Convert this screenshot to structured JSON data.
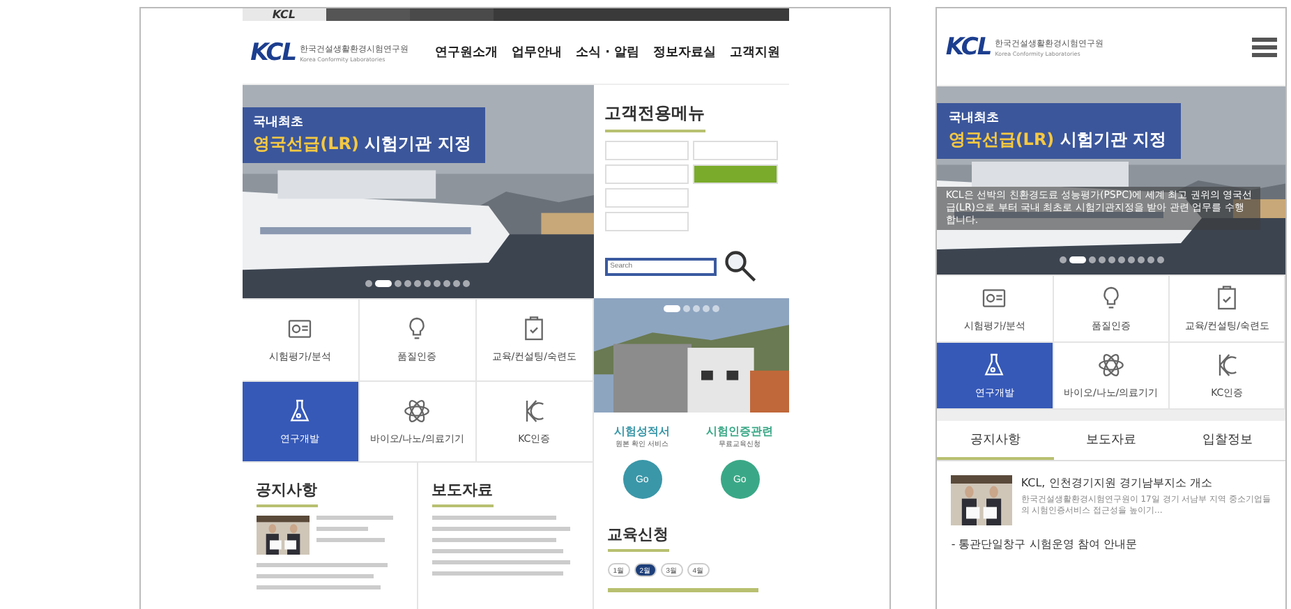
{
  "desktop": {
    "top_bar": {
      "logo": "KCL"
    },
    "header": {
      "logo": "KCL",
      "org_name": "한국건설생활환경시험연구원",
      "org_name_en": "Korea Conformity Laboratories",
      "nav": [
        "연구원소개",
        "업무안내",
        "소식 · 알림",
        "정보자료실",
        "고객지원"
      ]
    },
    "hero": {
      "kicker": "국내최초",
      "headline": "**영국선급(LR)** 시험기관 지정",
      "slides": [
        {
          "selected": false
        },
        {
          "selected": true
        },
        {
          "selected": false
        },
        {
          "selected": false
        },
        {
          "selected": false
        },
        {
          "selected": false
        },
        {
          "selected": false
        },
        {
          "selected": false
        },
        {
          "selected": false
        },
        {
          "selected": false
        }
      ]
    },
    "customer_menu": {
      "title": "고객전용메뉴",
      "search": {
        "placeholder": "Search"
      }
    },
    "services": [
      {
        "kind": "report",
        "label": "시험평가/분석",
        "selected": false
      },
      {
        "kind": "bulb",
        "label": "품질인증",
        "selected": false
      },
      {
        "kind": "clipboard",
        "label": "교육/컨설팅/숙련도",
        "selected": false
      },
      {
        "kind": "flask",
        "label": "연구개발",
        "selected": true
      },
      {
        "kind": "atom",
        "label": "바이오/나노/의료기기",
        "selected": false
      },
      {
        "kind": "kc",
        "label": "KC인증",
        "selected": false
      }
    ],
    "gallery": {
      "slides": [
        {
          "selected": true
        },
        {
          "selected": false
        },
        {
          "selected": false
        },
        {
          "selected": false
        },
        {
          "selected": false
        }
      ]
    },
    "shortcuts": [
      {
        "title": "시험성적서",
        "subtitle": "원본 확인 서비스",
        "button": "Go",
        "color": "#3a97a8"
      },
      {
        "title": "시험인증관련",
        "subtitle": "무료교육신청",
        "button": "Go",
        "color": "#3aa886"
      }
    ],
    "notices": {
      "title": "공지사항"
    },
    "press": {
      "title": "보도자료"
    },
    "education": {
      "title": "교육신청",
      "months": [
        {
          "label": "1월",
          "selected": false
        },
        {
          "label": "2월",
          "selected": true
        },
        {
          "label": "3월",
          "selected": false
        },
        {
          "label": "4월",
          "selected": false
        }
      ]
    }
  },
  "mobile": {
    "header": {
      "logo": "KCL",
      "org_name": "한국건설생활환경시험연구원",
      "org_name_en": "Korea Conformity Laboratories"
    },
    "hero": {
      "kicker": "국내최초",
      "headline": "**영국선급(LR)** 시험기관 지정",
      "body": "KCL은 선박의 친환경도료 성능평가(PSPC)에 세계 최고 권위의 영국선급(LR)으로 부터 국내 최초로 시험기관지정을 받아 관련 업무를 수행합니다.",
      "slides": [
        {
          "selected": false
        },
        {
          "selected": true
        },
        {
          "selected": false
        },
        {
          "selected": false
        },
        {
          "selected": false
        },
        {
          "selected": false
        },
        {
          "selected": false
        },
        {
          "selected": false
        },
        {
          "selected": false
        },
        {
          "selected": false
        }
      ]
    },
    "services": [
      {
        "kind": "report",
        "label": "시험평가/분석",
        "selected": false
      },
      {
        "kind": "bulb",
        "label": "품질인증",
        "selected": false
      },
      {
        "kind": "clipboard",
        "label": "교육/컨설팅/숙련도",
        "selected": false
      },
      {
        "kind": "flask",
        "label": "연구개발",
        "selected": true
      },
      {
        "kind": "atom",
        "label": "바이오/나노/의료기기",
        "selected": false
      },
      {
        "kind": "kc",
        "label": "KC인증",
        "selected": false
      }
    ],
    "tabs": [
      {
        "label": "공지사항",
        "selected": true
      },
      {
        "label": "보도자료",
        "selected": false
      },
      {
        "label": "입찰정보",
        "selected": false
      }
    ],
    "featured": {
      "title": "KCL, 인천경기지원 경기남부지소 개소",
      "summary": "한국건설생활환경시험연구원이 17일 경기 서남부 지역 중소기업들의 시험인증서비스 접근성을 높이기..."
    },
    "list": [
      "- 통관단일창구 시험운영 참여 안내문"
    ]
  }
}
